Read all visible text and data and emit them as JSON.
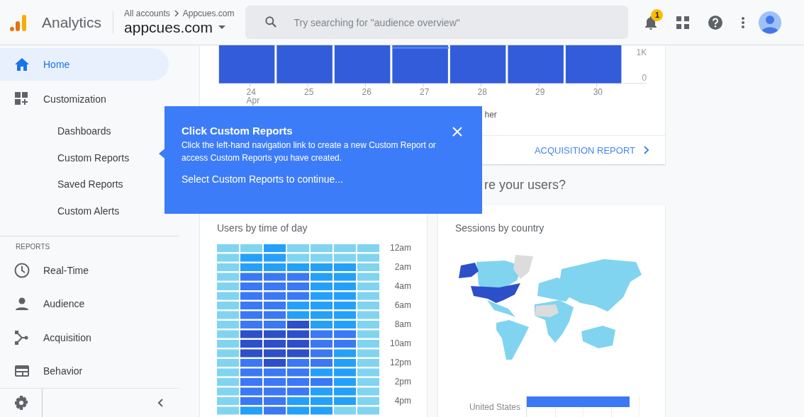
{
  "header": {
    "app_name": "Analytics",
    "breadcrumb": [
      "All accounts",
      "Appcues.com"
    ],
    "property": "appcues.com",
    "search": {
      "placeholder": "Try searching for \"audience overview\""
    },
    "notification_count": "1"
  },
  "sidebar": {
    "items": [
      {
        "label": "Home",
        "selected": true
      },
      {
        "label": "Customization",
        "selected": false,
        "children": [
          {
            "label": "Dashboards",
            "selected": false
          },
          {
            "label": "Custom Reports",
            "selected": false
          },
          {
            "label": "Saved Reports",
            "selected": false
          },
          {
            "label": "Custom Alerts",
            "selected": false
          }
        ]
      }
    ],
    "section_title": "REPORTS",
    "reports": [
      {
        "label": "Real-Time",
        "selected": false
      },
      {
        "label": "Audience",
        "selected": false
      },
      {
        "label": "Acquisition",
        "selected": false
      },
      {
        "label": "Behavior",
        "selected": false
      }
    ]
  },
  "overview_card": {
    "x_labels": [
      "24",
      "25",
      "26",
      "27",
      "28",
      "29",
      "30"
    ],
    "x_sublabel": "Apr",
    "y_labels": [
      "1K",
      "0"
    ],
    "legend_fragment": "her",
    "link": "ACQUISITION REPORT"
  },
  "section_heading": "re your users?",
  "time_card": {
    "title": "Users by time of day",
    "rows": [
      {
        "label": "12am",
        "cells": [
          {
            "color": "#80d4f0"
          },
          {
            "color": "#80d4f0"
          },
          {
            "color": "#24a0fa"
          },
          {
            "color": "#80d4f0"
          },
          {
            "color": "#80d4f0"
          },
          {
            "color": "#80d4f0"
          },
          {
            "color": "#80d4f0"
          }
        ]
      },
      {
        "cells": [
          {
            "color": "#80d4f0"
          },
          {
            "color": "#24a0fa"
          },
          {
            "color": "#24a0fa"
          },
          {
            "color": "#80d4f0"
          },
          {
            "color": "#80d4f0"
          },
          {
            "color": "#80d4f0"
          },
          {
            "color": "#80d4f0"
          }
        ]
      },
      {
        "label": "2am",
        "cells": [
          {
            "color": "#80d4f0"
          },
          {
            "color": "#24a0fa"
          },
          {
            "color": "#24a0fa"
          },
          {
            "color": "#24a0fa"
          },
          {
            "color": "#24a0fa"
          },
          {
            "color": "#24a0fa"
          },
          {
            "color": "#80d4f0"
          }
        ]
      },
      {
        "cells": [
          {
            "color": "#80d4f0"
          },
          {
            "color": "#3b78f5"
          },
          {
            "color": "#3b78f5"
          },
          {
            "color": "#3b78f5"
          },
          {
            "color": "#24a0fa"
          },
          {
            "color": "#24a0fa"
          },
          {
            "color": "#80d4f0"
          }
        ]
      },
      {
        "label": "4am",
        "cells": [
          {
            "color": "#80d4f0"
          },
          {
            "color": "#3b78f5"
          },
          {
            "color": "#3b78f5"
          },
          {
            "color": "#3b78f5"
          },
          {
            "color": "#24a0fa"
          },
          {
            "color": "#24a0fa"
          },
          {
            "color": "#80d4f0"
          }
        ]
      },
      {
        "cells": [
          {
            "color": "#80d4f0"
          },
          {
            "color": "#3b78f5"
          },
          {
            "color": "#3b78f5"
          },
          {
            "color": "#3b78f5"
          },
          {
            "color": "#24a0fa"
          },
          {
            "color": "#24a0fa"
          },
          {
            "color": "#80d4f0"
          }
        ]
      },
      {
        "label": "6am",
        "cells": [
          {
            "color": "#80d4f0"
          },
          {
            "color": "#3b78f5"
          },
          {
            "color": "#3b78f5"
          },
          {
            "color": "#24a0fa"
          },
          {
            "color": "#24a0fa"
          },
          {
            "color": "#24a0fa"
          },
          {
            "color": "#80d4f0"
          }
        ]
      },
      {
        "cells": [
          {
            "color": "#80d4f0"
          },
          {
            "color": "#3b78f5"
          },
          {
            "color": "#3b78f5"
          },
          {
            "color": "#24a0fa"
          },
          {
            "color": "#24a0fa"
          },
          {
            "color": "#24a0fa"
          },
          {
            "color": "#80d4f0"
          }
        ]
      },
      {
        "label": "8am",
        "cells": [
          {
            "color": "#80d4f0"
          },
          {
            "color": "#3b78f5"
          },
          {
            "color": "#3b78f5"
          },
          {
            "color": "#2d4fc9"
          },
          {
            "color": "#24a0fa"
          },
          {
            "color": "#24a0fa"
          },
          {
            "color": "#80d4f0"
          }
        ]
      },
      {
        "cells": [
          {
            "color": "#80d4f0"
          },
          {
            "color": "#2d4fc9"
          },
          {
            "color": "#2d4fc9"
          },
          {
            "color": "#2d4fc9"
          },
          {
            "color": "#3b78f5"
          },
          {
            "color": "#3b78f5"
          },
          {
            "color": "#80d4f0"
          }
        ]
      },
      {
        "label": "10am",
        "cells": [
          {
            "color": "#80d4f0"
          },
          {
            "color": "#2d4fc9"
          },
          {
            "color": "#2d4fc9"
          },
          {
            "color": "#2d4fc9"
          },
          {
            "color": "#3b78f5"
          },
          {
            "color": "#3b78f5"
          },
          {
            "color": "#80d4f0"
          }
        ]
      },
      {
        "cells": [
          {
            "color": "#80d4f0"
          },
          {
            "color": "#2d4fc9"
          },
          {
            "color": "#2d4fc9"
          },
          {
            "color": "#2d4fc9"
          },
          {
            "color": "#3b78f5"
          },
          {
            "color": "#24a0fa"
          },
          {
            "color": "#80d4f0"
          }
        ]
      },
      {
        "label": "12pm",
        "cells": [
          {
            "color": "#80d4f0"
          },
          {
            "color": "#3b78f5"
          },
          {
            "color": "#2d4fc9"
          },
          {
            "color": "#3b78f5"
          },
          {
            "color": "#3b78f5"
          },
          {
            "color": "#24a0fa"
          },
          {
            "color": "#80d4f0"
          }
        ]
      },
      {
        "cells": [
          {
            "color": "#80d4f0"
          },
          {
            "color": "#3b78f5"
          },
          {
            "color": "#3b78f5"
          },
          {
            "color": "#3b78f5"
          },
          {
            "color": "#24a0fa"
          },
          {
            "color": "#24a0fa"
          },
          {
            "color": "#80d4f0"
          }
        ]
      },
      {
        "label": "2pm",
        "cells": [
          {
            "color": "#80d4f0"
          },
          {
            "color": "#3b78f5"
          },
          {
            "color": "#3b78f5"
          },
          {
            "color": "#3b78f5"
          },
          {
            "color": "#3b78f5"
          },
          {
            "color": "#24a0fa"
          },
          {
            "color": "#80d4f0"
          }
        ]
      },
      {
        "cells": [
          {
            "color": "#80d4f0"
          },
          {
            "color": "#3b78f5"
          },
          {
            "color": "#3b78f5"
          },
          {
            "color": "#3b78f5"
          },
          {
            "color": "#24a0fa"
          },
          {
            "color": "#24a0fa"
          },
          {
            "color": "#80d4f0"
          }
        ]
      },
      {
        "label": "4pm",
        "cells": [
          {
            "color": "#80d4f0"
          },
          {
            "color": "#3b78f5"
          },
          {
            "color": "#3b78f5"
          },
          {
            "color": "#24a0fa"
          },
          {
            "color": "#24a0fa"
          },
          {
            "color": "#24a0fa"
          },
          {
            "color": "#80d4f0"
          }
        ]
      },
      {
        "cells": [
          {
            "color": "#80d4f0"
          },
          {
            "color": "#24a0fa"
          },
          {
            "color": "#3b78f5"
          },
          {
            "color": "#24a0fa"
          },
          {
            "color": "#24a0fa"
          },
          {
            "color": "#80d4f0"
          },
          {
            "color": "#80d4f0"
          }
        ]
      }
    ]
  },
  "country_card": {
    "title": "Sessions by country",
    "countries": [
      {
        "name": "United States",
        "level": 0.92
      }
    ]
  },
  "tooltip": {
    "title": "Click Custom Reports",
    "body": "Click the left-hand navigation link to create a new Custom Report or access Custom Reports you have created.",
    "instruction": "Select Custom Reports to continue..."
  }
}
